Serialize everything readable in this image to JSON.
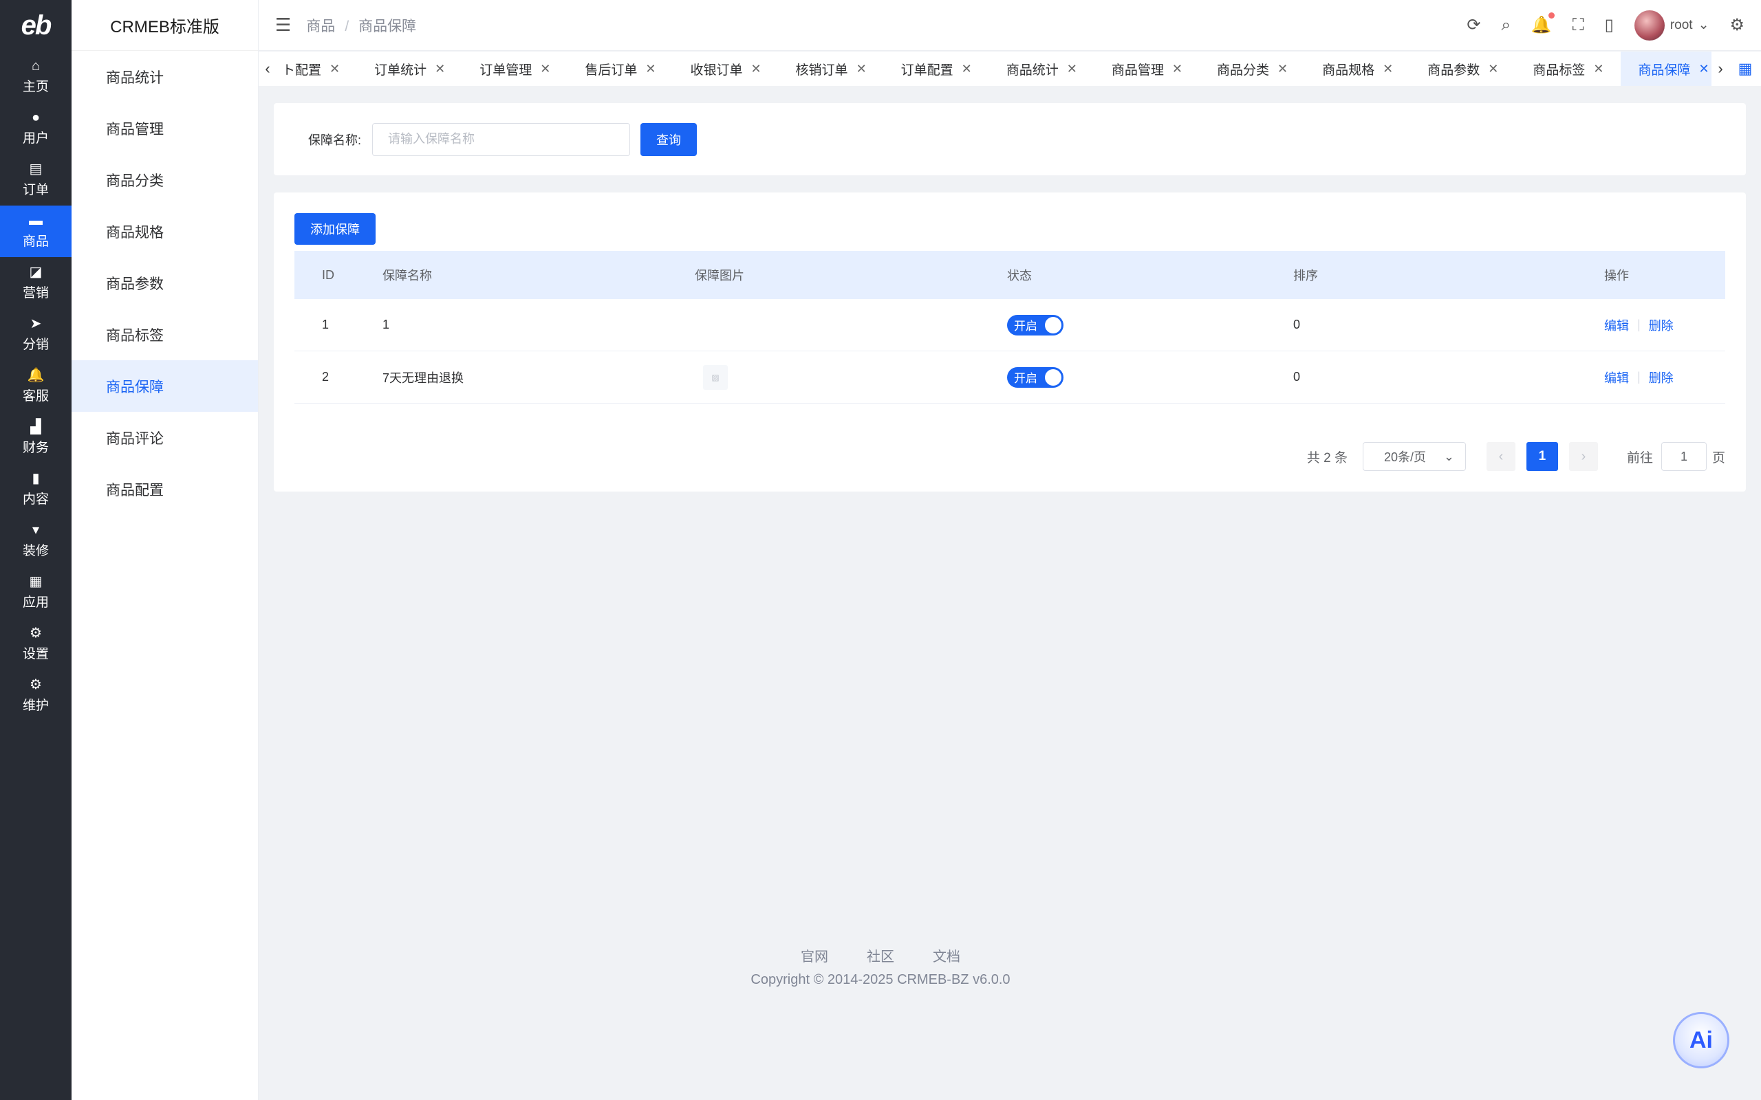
{
  "rail": {
    "logo": "eb",
    "items": [
      {
        "label": "主页",
        "icon": "⌂"
      },
      {
        "label": "用户",
        "icon": "●"
      },
      {
        "label": "订单",
        "icon": "▤"
      },
      {
        "label": "商品",
        "icon": "▬"
      },
      {
        "label": "营销",
        "icon": "◪"
      },
      {
        "label": "分销",
        "icon": "➤"
      },
      {
        "label": "客服",
        "icon": "🔔"
      },
      {
        "label": "财务",
        "icon": "▟"
      },
      {
        "label": "内容",
        "icon": "▮"
      },
      {
        "label": "装修",
        "icon": "▾"
      },
      {
        "label": "应用",
        "icon": "▦"
      },
      {
        "label": "设置",
        "icon": "⚙"
      },
      {
        "label": "维护",
        "icon": "⚙"
      }
    ]
  },
  "submenu": {
    "brand": "CRMEB标准版",
    "items": [
      "商品统计",
      "商品管理",
      "商品分类",
      "商品规格",
      "商品参数",
      "商品标签",
      "商品保障",
      "商品评论",
      "商品配置"
    ]
  },
  "header": {
    "breadcrumb": [
      "商品",
      "商品保障"
    ],
    "username": "root"
  },
  "tabs": [
    "ト配置",
    "订单统计",
    "订单管理",
    "售后订单",
    "收银订单",
    "核销订单",
    "订单配置",
    "商品统计",
    "商品管理",
    "商品分类",
    "商品规格",
    "商品参数",
    "商品标签",
    "商品保障"
  ],
  "search": {
    "label": "保障名称:",
    "placeholder": "请输入保障名称",
    "button": "查询"
  },
  "table": {
    "add_button": "添加保障",
    "headers": [
      "ID",
      "保障名称",
      "保障图片",
      "状态",
      "排序",
      "操作"
    ],
    "rows": [
      {
        "id": "1",
        "name": "1",
        "status": "开启",
        "sort": "0"
      },
      {
        "id": "2",
        "name": "7天无理由退换",
        "status": "开启",
        "sort": "0"
      }
    ],
    "edit": "编辑",
    "delete": "删除"
  },
  "pagination": {
    "total": "共 2 条",
    "page_size": "20条/页",
    "current": "1",
    "goto_label": "前往",
    "goto_value": "1",
    "page_suffix": "页"
  },
  "footer": {
    "links": [
      "官网",
      "社区",
      "文档"
    ],
    "copyright": "Copyright © 2014-2025 CRMEB-BZ v6.0.0"
  },
  "ai_label": "Ai",
  "colors": {
    "primary": "#1a64f4",
    "rail_bg": "#282c34"
  }
}
